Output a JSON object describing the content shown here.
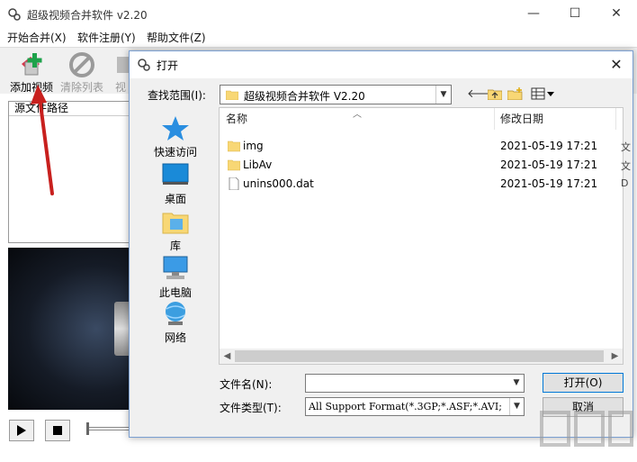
{
  "main": {
    "title": "超级视频合并软件 v2.20",
    "controls": {
      "minimize": "—",
      "maximize": "☐",
      "close": "✕"
    },
    "menu": [
      "开始合并(X)",
      "软件注册(Y)",
      "帮助文件(Z)"
    ],
    "toolbar": {
      "add_video": "添加视频",
      "clear_list": "清除列表",
      "third": "视"
    },
    "file_list_header": "源文件路径"
  },
  "dialog": {
    "title": "打开",
    "close": "✕",
    "lookin_label": "查找范围(I):",
    "lookin_value": "超级视频合并软件 V2.20",
    "places": [
      "快速访问",
      "桌面",
      "库",
      "此电脑",
      "网络"
    ],
    "columns": {
      "name": "名称",
      "date": "修改日期"
    },
    "files": [
      {
        "name": "img",
        "type": "folder",
        "date": "2021-05-19 17:21",
        "extra": "文"
      },
      {
        "name": "LibAv",
        "type": "folder",
        "date": "2021-05-19 17:21",
        "extra": "文"
      },
      {
        "name": "unins000.dat",
        "type": "file",
        "date": "2021-05-19 17:21",
        "extra": "D"
      }
    ],
    "filename_label": "文件名(N):",
    "filename_value": "",
    "filetype_label": "文件类型(T):",
    "filetype_value": "All Support Format(*.3GP;*.ASF;*.AVI;",
    "open_button": "打开(O)",
    "cancel_button": "取消"
  },
  "colors": {
    "accent": "#0078d7",
    "folder": "#f8d775",
    "arrow": "#c8201e"
  }
}
